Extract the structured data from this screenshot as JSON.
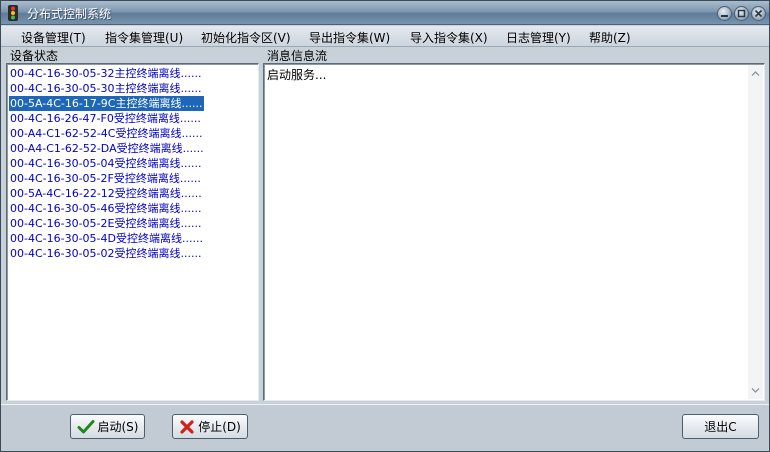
{
  "window": {
    "title": "分布式控制系统"
  },
  "menu": [
    {
      "label": "设备管理(T)"
    },
    {
      "label": "指令集管理(U)"
    },
    {
      "label": "初始化指令区(V)"
    },
    {
      "label": "导出指令集(W)"
    },
    {
      "label": "导入指令集(X)"
    },
    {
      "label": "日志管理(Y)"
    },
    {
      "label": "帮助(Z)"
    }
  ],
  "device_panel": {
    "label": "设备状态",
    "items": [
      {
        "text": "00-4C-16-30-05-32主控终端离线......",
        "selected": false
      },
      {
        "text": "00-4C-16-30-05-30主控终端离线......",
        "selected": false
      },
      {
        "text": "00-5A-4C-16-17-9C主控终端离线......",
        "selected": true
      },
      {
        "text": "00-4C-16-26-47-F0受控终端离线......",
        "selected": false
      },
      {
        "text": "00-A4-C1-62-52-4C受控终端离线......",
        "selected": false
      },
      {
        "text": "00-A4-C1-62-52-DA受控终端离线......",
        "selected": false
      },
      {
        "text": "00-4C-16-30-05-04受控终端离线......",
        "selected": false
      },
      {
        "text": "00-4C-16-30-05-2F受控终端离线......",
        "selected": false
      },
      {
        "text": "00-5A-4C-16-22-12受控终端离线......",
        "selected": false
      },
      {
        "text": "00-4C-16-30-05-46受控终端离线......",
        "selected": false
      },
      {
        "text": "00-4C-16-30-05-2E受控终端离线......",
        "selected": false
      },
      {
        "text": "00-4C-16-30-05-4D受控终端离线......",
        "selected": false
      },
      {
        "text": "00-4C-16-30-05-02受控终端离线......",
        "selected": false
      }
    ]
  },
  "message_panel": {
    "label": "消息信息流",
    "text": "启动服务..."
  },
  "buttons": {
    "start": "启动(S)",
    "stop": "停止(D)",
    "exit": "退出C"
  },
  "colors": {
    "list_text": "#0000cc",
    "selection": "#1d66b8",
    "titlebar": "#7f98b0"
  }
}
